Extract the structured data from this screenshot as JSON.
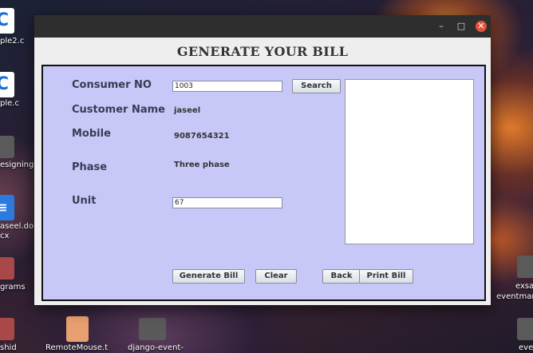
{
  "desktop": {
    "icons": [
      {
        "label": "ple2.c"
      },
      {
        "label": "ple.c"
      },
      {
        "label": "esigning"
      },
      {
        "label": "aseel.do-"
      },
      {
        "label": "cx"
      },
      {
        "label": "grams"
      },
      {
        "label": "shid"
      },
      {
        "label": "RemoteMouse.t"
      },
      {
        "label": "django-event-"
      },
      {
        "label": "exsa"
      },
      {
        "label": "eventmar"
      },
      {
        "label": "eve"
      }
    ]
  },
  "window": {
    "title": "GENERATE YOUR BILL",
    "controls": {
      "minimize": "–",
      "maximize": "□",
      "close": "✕"
    }
  },
  "form": {
    "consumer_no": {
      "label": "Consumer NO",
      "value": "1003"
    },
    "search_button": "Search",
    "customer_name": {
      "label": "Customer Name",
      "value": "jaseel"
    },
    "mobile": {
      "label": "Mobile",
      "value": "9087654321"
    },
    "phase": {
      "label": "Phase",
      "value": "Three phase"
    },
    "unit": {
      "label": "Unit",
      "value": "67"
    },
    "bill_output": ""
  },
  "buttons": {
    "generate": "Generate Bill",
    "clear": "Clear",
    "back": "Back",
    "print": "Print Bill"
  }
}
